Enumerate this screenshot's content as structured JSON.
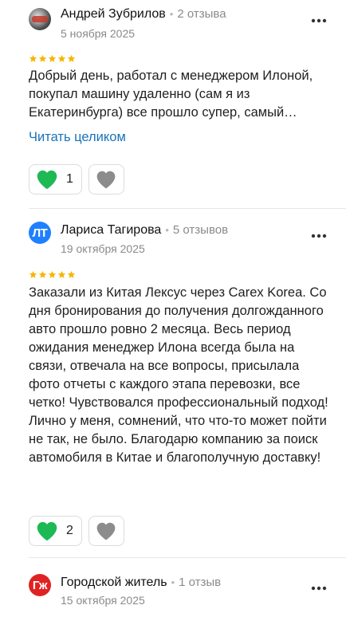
{
  "reviews": [
    {
      "author": "Андрей Зубрилов",
      "reviews_count": "2 отзыва",
      "date": "5 ноября 2025",
      "rating": 5,
      "text": "Добрый день, работал с менеджером Илоной, покупал машину удаленно (сам я из Екатеринбурга) все прошло супер, самый…",
      "read_more": "Читать целиком",
      "likes": "1"
    },
    {
      "avatar_initials": "ЛТ",
      "author": "Лариса Тагирова",
      "reviews_count": "5 отзывов",
      "date": "19 октября 2025",
      "rating": 5,
      "text": "Заказали из Китая Лексус через Carex Korea. Со дня бронирования до получения долгожданного авто прошло ровно 2 месяца. Весь период ожидания менеджер Илона всегда была на связи, отвечала на все вопросы, присылала фото отчеты с каждого этапа перевозки, все четко! Чувствовался профессиональный подход! Лично у меня, сомнений, что что-то может пойти не так, не было. Благодарю компанию за поиск автомобиля в Китае и благополучную доставку!",
      "likes": "2"
    },
    {
      "avatar_initials": "Гж",
      "author": "Городской житель",
      "reviews_count": "1 отзыв",
      "date": "15 октября 2025"
    }
  ],
  "colors": {
    "star": "#f7b500",
    "heart_green": "#1db954",
    "heart_grey": "#8c8c8c",
    "link": "#1a73b9",
    "avatar_lt": "#1f80ff",
    "avatar_gzh": "#e02222"
  },
  "icons": [
    "more-dots-icon",
    "star-icon",
    "heart-like-icon",
    "heart-dislike-icon"
  ]
}
